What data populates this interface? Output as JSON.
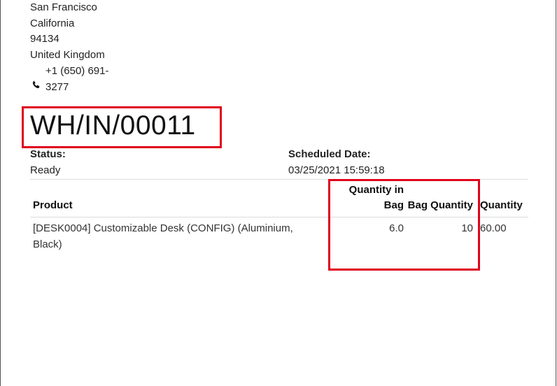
{
  "address": {
    "lines": [
      "San Francisco",
      "California",
      "94134",
      "United Kingdom"
    ],
    "phone": [
      "+1 (650) 691-",
      "3277"
    ],
    "phone_icon": "phone-icon"
  },
  "document": {
    "reference": "WH/IN/00011",
    "status_label": "Status:",
    "status_value": "Ready",
    "scheduled_label": "Scheduled Date:",
    "scheduled_value": "03/25/2021 15:59:18"
  },
  "table": {
    "headers": {
      "product": "Product",
      "qty_in_bag_line1": "Quantity in",
      "qty_in_bag_line2": "Bag",
      "bag_quantity": "Bag Quantity",
      "quantity": "Quantity"
    },
    "rows": [
      {
        "product_line1": "[DESK0004] Customizable Desk (CONFIG) (Aluminium,",
        "product_line2": "Black)",
        "qty_in_bag": "6.0",
        "bag_quantity": "10",
        "quantity": "60.00"
      }
    ]
  },
  "colors": {
    "highlight": "#e0001b"
  }
}
